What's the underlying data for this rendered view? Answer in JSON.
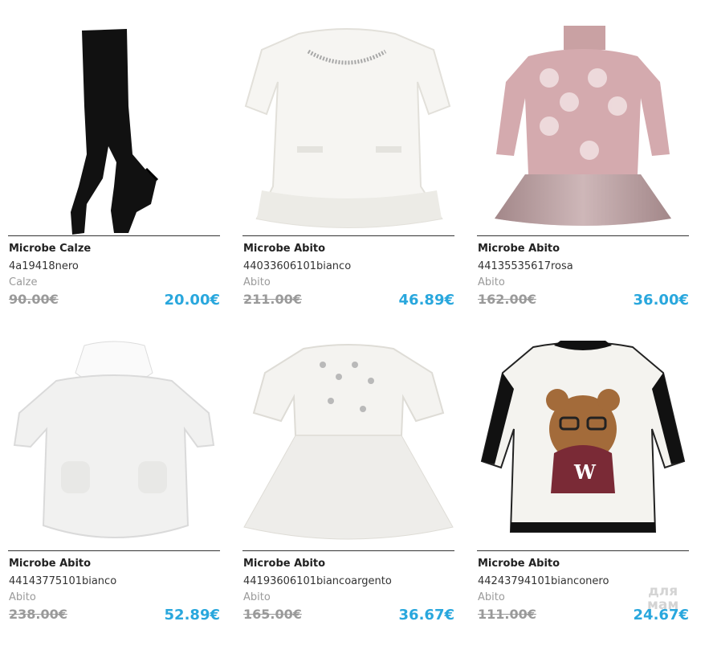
{
  "products": [
    {
      "title": "Microbe Calze",
      "code": "4a19418nero",
      "category": "Calze",
      "old_price": "90.00€",
      "price": "20.00€",
      "icon": "tights-image"
    },
    {
      "title": "Microbe Abito",
      "code": "44033606101bianco",
      "category": "Abito",
      "old_price": "211.00€",
      "price": "46.89€",
      "icon": "white-dress-image"
    },
    {
      "title": "Microbe Abito",
      "code": "44135535617rosa",
      "category": "Abito",
      "old_price": "162.00€",
      "price": "36.00€",
      "icon": "pink-dress-image"
    },
    {
      "title": "Microbe Abito",
      "code": "44143775101bianco",
      "category": "Abito",
      "old_price": "238.00€",
      "price": "52.89€",
      "icon": "knit-dress-image"
    },
    {
      "title": "Microbe Abito",
      "code": "44193606101biancoargento",
      "category": "Abito",
      "old_price": "165.00€",
      "price": "36.67€",
      "icon": "tulle-dress-image"
    },
    {
      "title": "Microbe Abito",
      "code": "44243794101bianconero",
      "category": "Abito",
      "old_price": "111.00€",
      "price": "24.67€",
      "icon": "bear-sweatshirt-image"
    }
  ],
  "watermark": {
    "line1": "для",
    "line2": "мам"
  },
  "colors": {
    "price": "#29a7dd",
    "old_price": "#9a9a9a",
    "rule": "#333333"
  }
}
